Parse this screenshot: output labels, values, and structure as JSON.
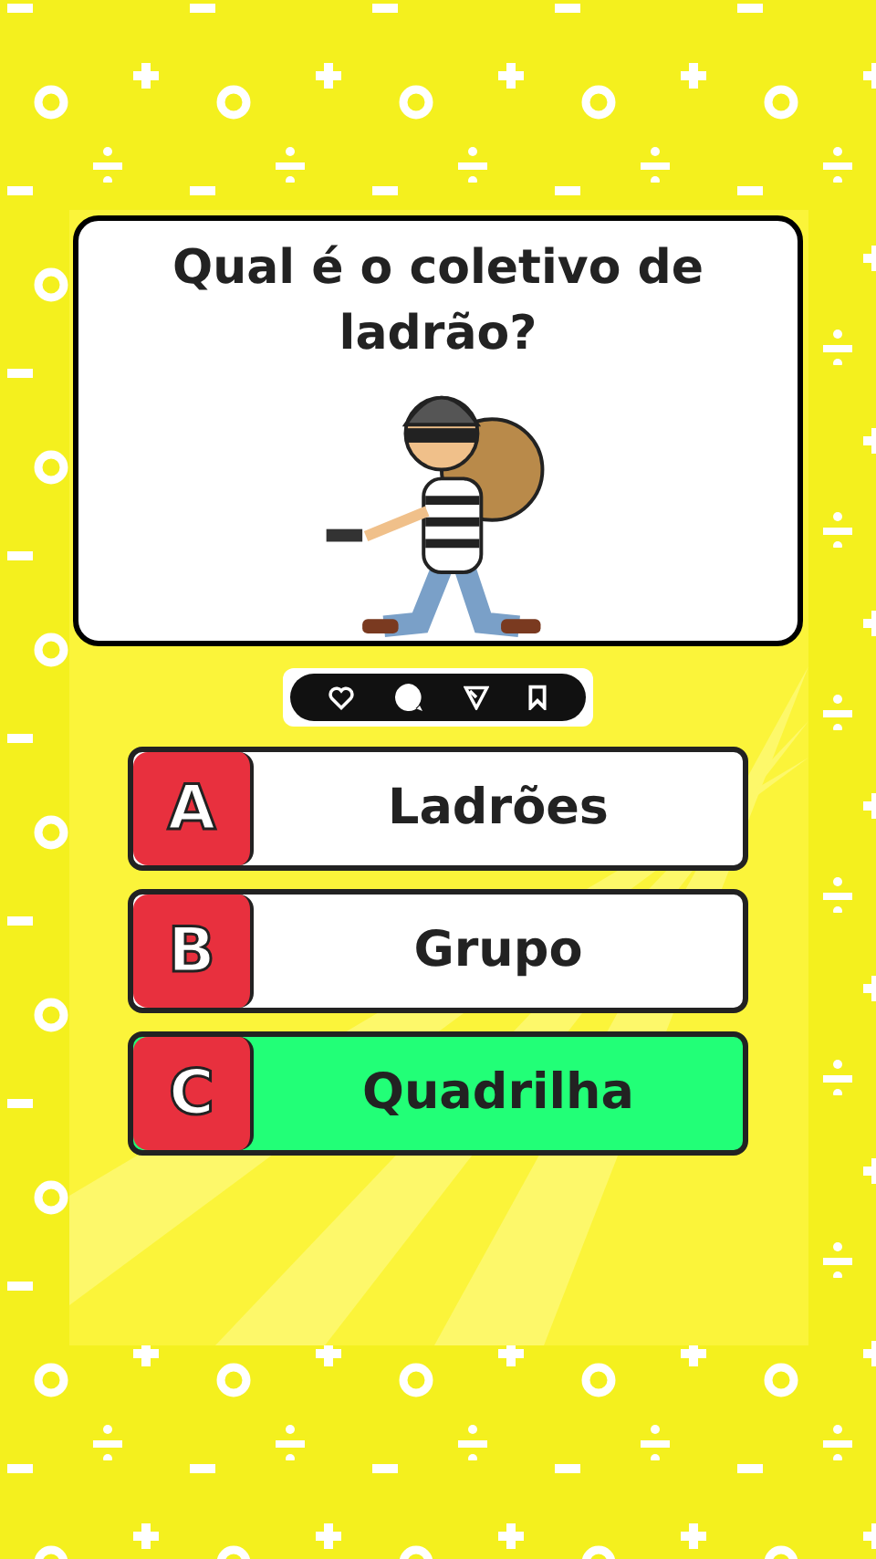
{
  "question": "Qual é o coletivo de ladrão?",
  "answers": [
    {
      "letter": "A",
      "text": "Ladrões",
      "selected": false
    },
    {
      "letter": "B",
      "text": "Grupo",
      "selected": false
    },
    {
      "letter": "C",
      "text": "Quadrilha",
      "selected": true
    }
  ]
}
